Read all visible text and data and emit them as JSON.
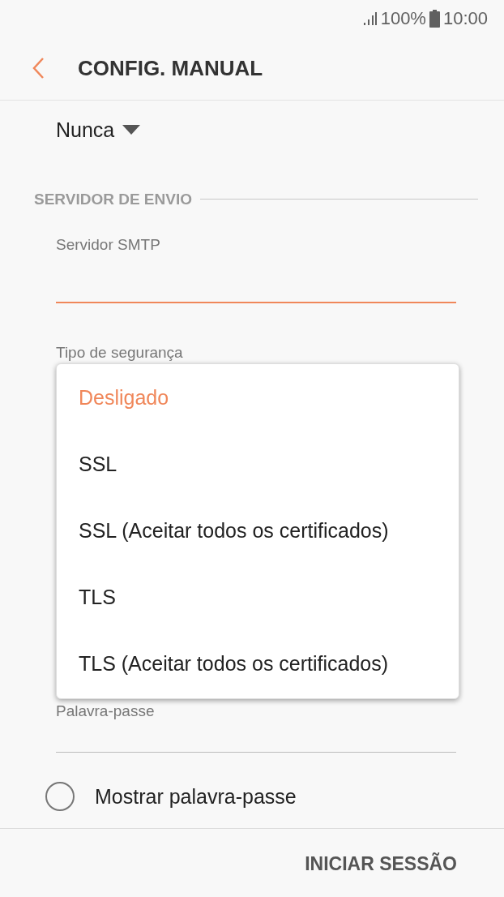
{
  "status_bar": {
    "battery": "100%",
    "time": "10:00"
  },
  "header": {
    "title": "CONFIG. MANUAL"
  },
  "sync_dropdown": {
    "value": "Nunca"
  },
  "section": {
    "title": "SERVIDOR DE ENVIO"
  },
  "smtp_field": {
    "label": "Servidor SMTP",
    "focused": true
  },
  "security_label": "Tipo de segurança",
  "security_menu": [
    {
      "label": "Desligado",
      "selected": true
    },
    {
      "label": "SSL",
      "selected": false
    },
    {
      "label": "SSL (Aceitar todos os certificados)",
      "selected": false
    },
    {
      "label": "TLS",
      "selected": false
    },
    {
      "label": "TLS (Aceitar todos os certificados)",
      "selected": false
    }
  ],
  "password_field": {
    "label": "Palavra-passe",
    "focused": false
  },
  "show_password": {
    "label": "Mostrar palavra-passe",
    "checked": false
  },
  "action_button": "INICIAR SESSÃO"
}
